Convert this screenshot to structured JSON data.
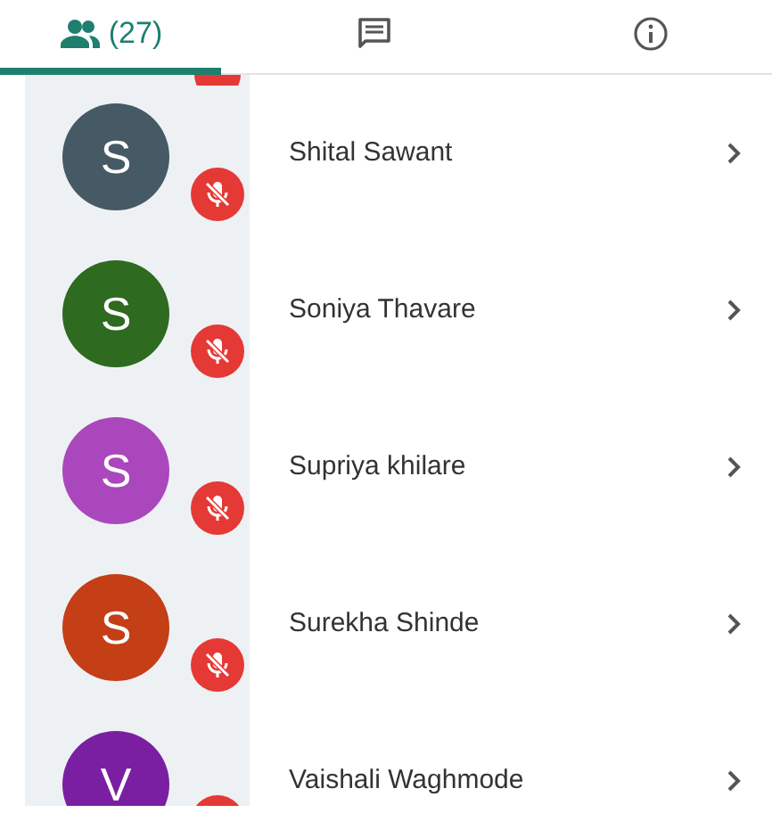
{
  "tabs": [
    {
      "kind": "people",
      "label": "(27)",
      "selected": true
    },
    {
      "kind": "chat",
      "selected": false
    },
    {
      "kind": "info",
      "selected": false
    }
  ],
  "participants": [
    {
      "initial": "S",
      "name": "Shital Sawant",
      "color": "#455a64",
      "muted": true
    },
    {
      "initial": "S",
      "name": "Soniya Thavare",
      "color": "#2e6a1f",
      "muted": true
    },
    {
      "initial": "S",
      "name": "Supriya khilare",
      "color": "#ab47bc",
      "muted": true
    },
    {
      "initial": "S",
      "name": "Surekha Shinde",
      "color": "#c43e16",
      "muted": true
    },
    {
      "initial": "V",
      "name": "Vaishali Waghmode",
      "color": "#7a1fa2",
      "muted": true
    }
  ]
}
